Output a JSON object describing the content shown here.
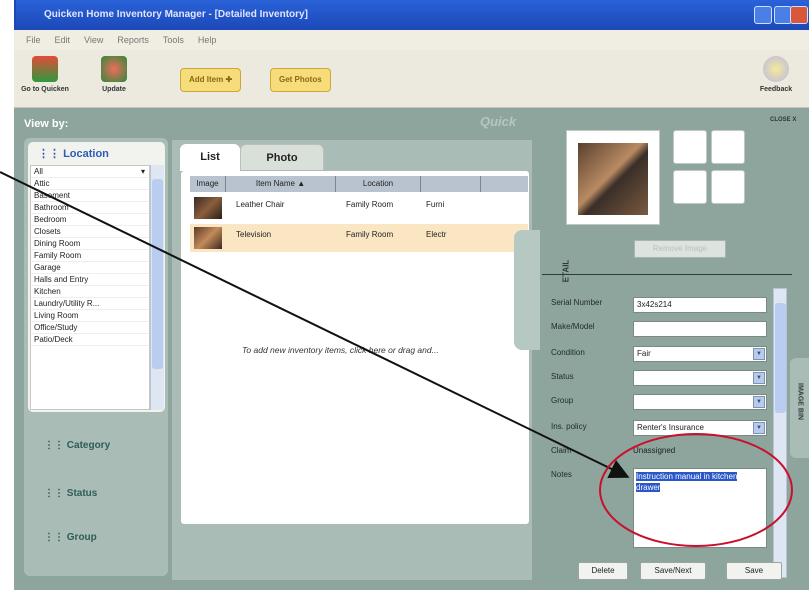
{
  "window": {
    "title": "Quicken Home Inventory Manager - [Detailed Inventory]"
  },
  "menu": [
    "File",
    "Edit",
    "View",
    "Reports",
    "Tools",
    "Help"
  ],
  "toolbar": {
    "go_to_quicken": "Go to Quicken",
    "update": "Update",
    "add_item": "Add Item ✚",
    "get_photos": "Get Photos",
    "feedback": "Feedback"
  },
  "viewby": "View by:",
  "watermark": "Quick",
  "location": {
    "header": "Location",
    "items": [
      "All",
      "Attic",
      "Basement",
      "Bathroom",
      "Bedroom",
      "Closets",
      "Dining Room",
      "Family Room",
      "Garage",
      "Halls and Entry",
      "Kitchen",
      "Laundry/Utility R...",
      "Living Room",
      "Office/Study",
      "Patio/Deck"
    ]
  },
  "groups": {
    "category": "Category",
    "status": "Status",
    "group": "Group"
  },
  "tabs": {
    "list": "List",
    "photo": "Photo"
  },
  "table": {
    "headers": {
      "image": "Image",
      "name": "Item Name",
      "location": "Location",
      "category": ""
    },
    "rows": [
      {
        "name": "Leather Chair",
        "location": "Family Room",
        "category": "Furni"
      },
      {
        "name": "Television",
        "location": "Family Room",
        "category": "Electr"
      }
    ]
  },
  "hint": "To add new inventory items, click here or drag and...",
  "close_label": "CLOSE X",
  "remove_image": "Remove Image",
  "detail_tab": "ITEM DETAIL",
  "image_bin_tab": "IMAGE BIN",
  "form": {
    "serial_label": "Serial Number",
    "serial_value": "3x42s214",
    "make_label": "Make/Model",
    "make_value": "",
    "condition_label": "Condition",
    "condition_value": "Fair",
    "status_label": "Status",
    "status_value": "",
    "group_label": "Group",
    "group_value": "",
    "ins_label": "Ins. policy",
    "ins_value": "Renter's Insurance",
    "claim_label": "Claim",
    "claim_value": "Unassigned",
    "notes_label": "Notes",
    "notes_value": "Instruction manual in kitchen drawer"
  },
  "buttons": {
    "delete": "Delete",
    "save_next": "Save/Next",
    "save": "Save"
  },
  "colors": {
    "annotation": "#c8102e",
    "selection": "#2a56c8",
    "title_bar": "#2a62d8"
  }
}
